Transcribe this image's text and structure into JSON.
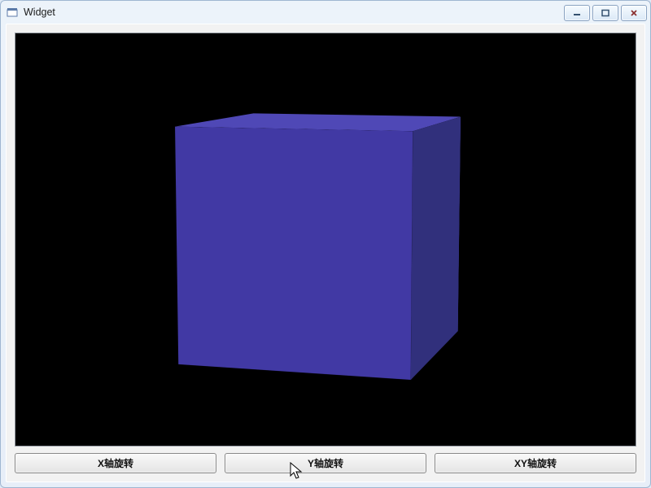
{
  "window": {
    "title": "Widget"
  },
  "buttons": {
    "x_rotate": "X轴旋转",
    "y_rotate": "Y轴旋转",
    "xy_rotate": "XY轴旋转"
  },
  "colors": {
    "viewport_bg": "#000000",
    "cube_front": "#4139a4",
    "cube_left": "#d321b4",
    "cube_top": "#4f48b6"
  }
}
